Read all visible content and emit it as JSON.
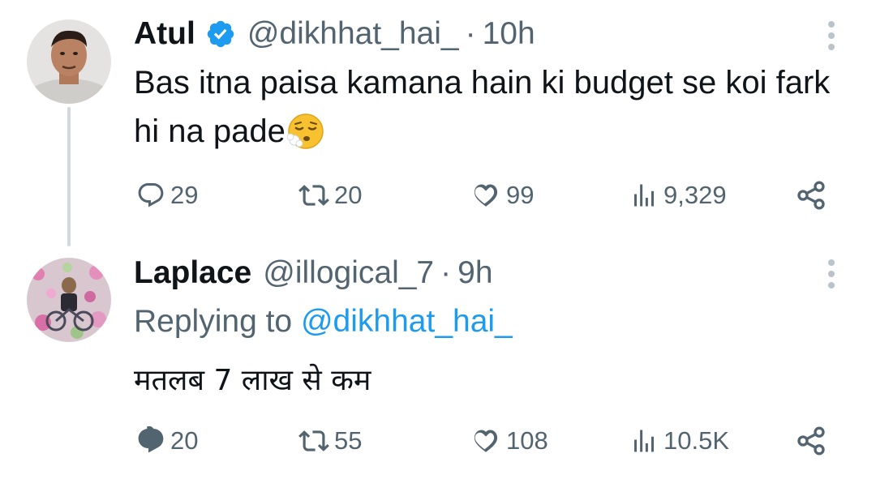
{
  "tweets": [
    {
      "name": "Atul",
      "verified": true,
      "handle": "@dikhhat_hai_",
      "separator": "·",
      "time": "10h",
      "text": "Bas itna paisa kamana hain ki budget se koi fark hi na pade",
      "emoji_icon": "exhaling-face-emoji-icon",
      "stats": {
        "replies": "29",
        "retweets": "20",
        "likes": "99",
        "views": "9,329"
      }
    },
    {
      "name": "Laplace",
      "verified": false,
      "handle": "@illogical_7",
      "separator": "·",
      "time": "9h",
      "reply_prefix": "Replying to",
      "reply_handle": "@dikhhat_hai_",
      "text": "मतलब 7 लाख से कम",
      "stats": {
        "replies": "20",
        "retweets": "55",
        "likes": "108",
        "views": "10.5K"
      }
    }
  ],
  "icons": {
    "reply": "reply-icon",
    "retweet": "retweet-icon",
    "like": "heart-icon",
    "views": "views-icon",
    "share": "share-icon",
    "more": "more-options-icon",
    "verified": "verified-badge-icon"
  },
  "colors": {
    "text": "#0f1419",
    "secondary": "#536471",
    "link": "#1d9bf0",
    "verified": "#1d9bf0",
    "thread_line": "#cfd9de"
  }
}
